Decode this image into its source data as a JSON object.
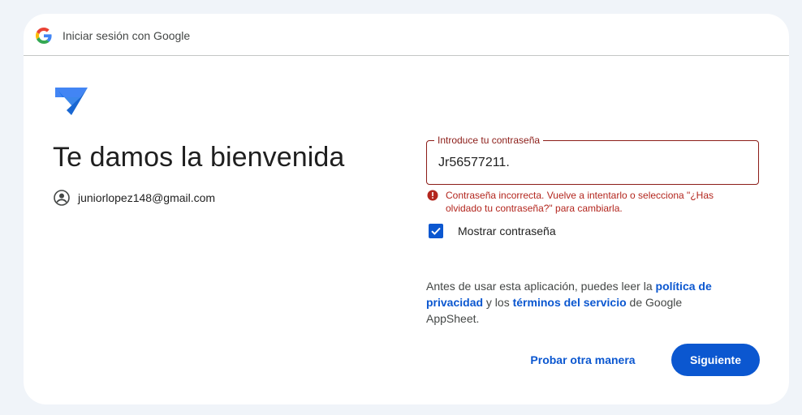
{
  "header": {
    "title": "Iniciar sesión con Google",
    "logo_icon": "google-g-icon"
  },
  "app": {
    "logo_icon": "appsheet-logo-icon",
    "brand_color": "#1a73e8"
  },
  "main": {
    "title": "Te damos la bienvenida",
    "account_email": "juniorlopez148@gmail.com",
    "account_icon": "account-circle-icon"
  },
  "password": {
    "label": "Introduce tu contraseña",
    "value": "Jr56577211."
  },
  "error": {
    "icon": "error-icon",
    "message": "Contraseña incorrecta. Vuelve a intentarlo o selecciona \"¿Has olvidado tu contraseña?\" para cambiarla.",
    "color": "#b3261e"
  },
  "show_password": {
    "label": "Mostrar contraseña",
    "checked": true
  },
  "legal": {
    "prefix": "Antes de usar esta aplicación, puedes leer la ",
    "privacy_link": "política de privacidad",
    "middle": " y los ",
    "terms_link": "términos del servicio",
    "suffix": " de Google AppSheet."
  },
  "actions": {
    "alt_label": "Probar otra manera",
    "next_label": "Siguiente",
    "primary_color": "#0b57d0"
  }
}
